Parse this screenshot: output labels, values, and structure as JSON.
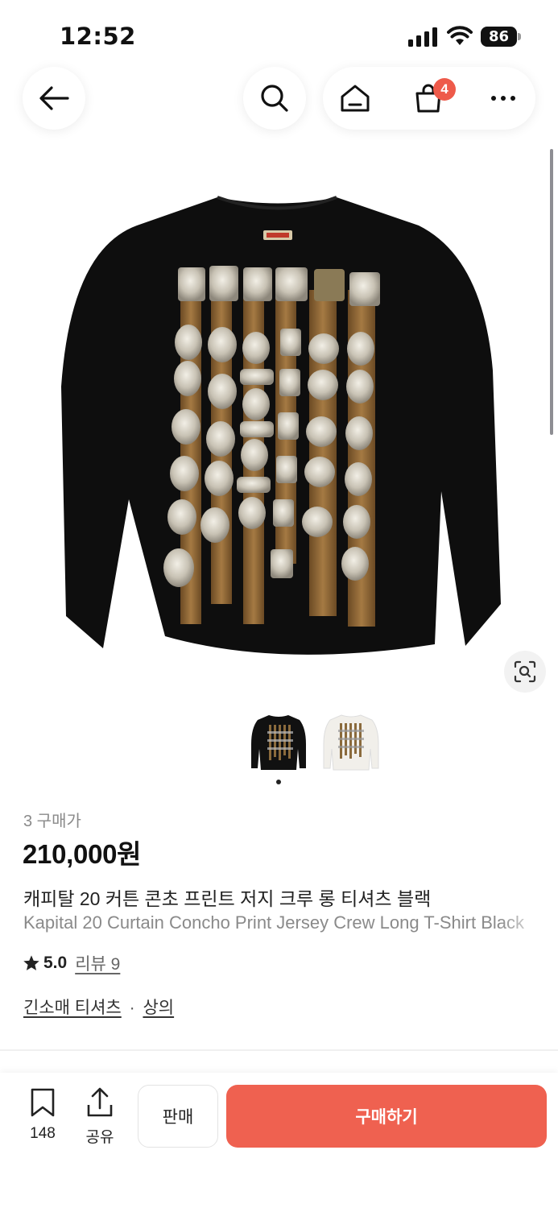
{
  "status_bar": {
    "time": "12:52",
    "battery": "86"
  },
  "nav": {
    "cart_count": "4"
  },
  "product": {
    "purchase_count": "3 구매가",
    "price": "210,000원",
    "name_ko": "캐피탈 20 커튼 콘초 프린트 저지 크루 롱 티셔츠 블랙",
    "name_en": "Kapital 20 Curtain Concho Print Jersey Crew Long T-Shirt Black",
    "rating": "5.0",
    "review_label": "리뷰 9",
    "category_primary": "긴소매 티셔츠",
    "category_separator": "·",
    "category_secondary": "상의",
    "shirt_brand_tag": "KAPITAL"
  },
  "bottom_bar": {
    "save_count": "148",
    "share_label": "공유",
    "sell_label": "판매",
    "buy_label": "구매하기"
  },
  "colors": {
    "accent": "#ef6150",
    "badge": "#ee5a4a"
  }
}
